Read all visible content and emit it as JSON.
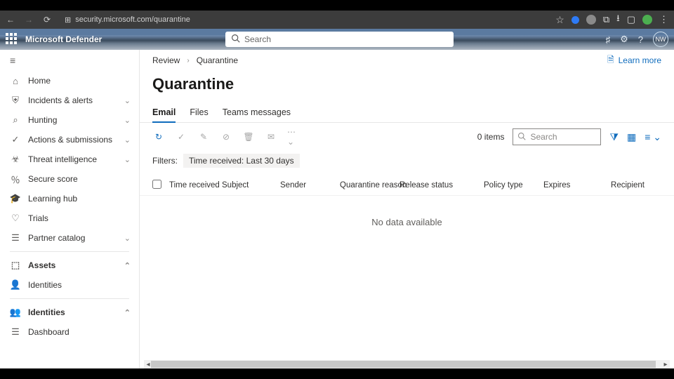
{
  "browser": {
    "url_display": "security.microsoft.com/quarantine"
  },
  "header": {
    "brand": "Microsoft Defender",
    "search_placeholder": "Search",
    "avatar_initials": "NW"
  },
  "sidebar": {
    "items": [
      {
        "icon": "home",
        "label": "Home",
        "chev": false
      },
      {
        "icon": "shield",
        "label": "Incidents & alerts",
        "chev": true
      },
      {
        "icon": "hunt",
        "label": "Hunting",
        "chev": true
      },
      {
        "icon": "actions",
        "label": "Actions & submissions",
        "chev": true
      },
      {
        "icon": "threat",
        "label": "Threat intelligence",
        "chev": true
      },
      {
        "icon": "score",
        "label": "Secure score",
        "chev": false
      },
      {
        "icon": "learn",
        "label": "Learning hub",
        "chev": false
      },
      {
        "icon": "trials",
        "label": "Trials",
        "chev": false
      },
      {
        "icon": "partner",
        "label": "Partner catalog",
        "chev": true
      }
    ],
    "group1": {
      "label": "Assets",
      "chev": "up",
      "icon": "assets",
      "children": [
        {
          "icon": "person",
          "label": "Identities"
        }
      ]
    },
    "group2": {
      "label": "Identities",
      "chev": "up",
      "icon": "identities",
      "children": [
        {
          "icon": "dash",
          "label": "Dashboard"
        }
      ]
    }
  },
  "breadcrumb": {
    "a": "Review",
    "b": "Quarantine"
  },
  "learn_more": "Learn more",
  "page_title": "Quarantine",
  "tabs": {
    "t1": "Email",
    "t2": "Files",
    "t3": "Teams messages"
  },
  "toolbar": {
    "items_count": "0 items",
    "search_placeholder": "Search"
  },
  "filters": {
    "label": "Filters:",
    "pill_key": "Time received:",
    "pill_val": "Last 30 days"
  },
  "columns": {
    "time_received": "Time received",
    "subject": "Subject",
    "sender": "Sender",
    "quarantine_reason": "Quarantine reason",
    "release_status": "Release status",
    "policy_type": "Policy type",
    "expires": "Expires",
    "recipient": "Recipient"
  },
  "empty_state": "No data available"
}
